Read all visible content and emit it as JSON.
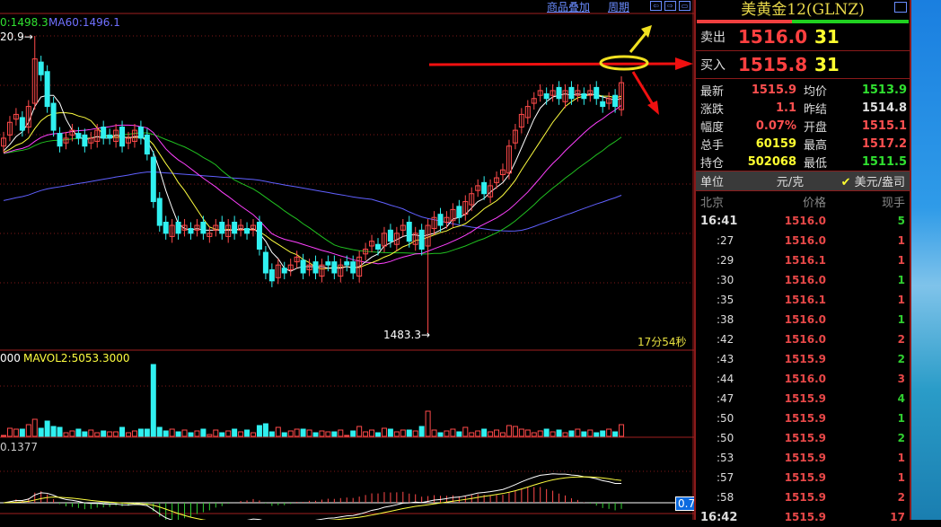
{
  "toolbar": {
    "overlay_link": "商品叠加",
    "period_link": "周期"
  },
  "main_chart": {
    "ma30_label": "0:1498.3",
    "ma60_label": "MA60:1496.1",
    "high_marker": "20.9→",
    "low_marker": "1483.3→",
    "countdown": "17分54秒",
    "colors": {
      "up": "#ff4a4a",
      "down": "#30f0f0",
      "ma5": "#ffffff",
      "ma10": "#ffff40",
      "ma20": "#ff40ff",
      "ma30": "#20c020",
      "ma60": "#6060ff"
    }
  },
  "volume_panel": {
    "mavol1_label": "000",
    "mavol2_label": "MAVOL2:5053.3000"
  },
  "macd_panel": {
    "value_label": "0.1377",
    "badge": "0.7"
  },
  "chart_data": {
    "type": "candlestick",
    "price_range": [
      1483.3,
      1520.9
    ],
    "high": 1520.9,
    "low": 1483.3,
    "closes": [
      1508,
      1510,
      1511,
      1509,
      1512,
      1518,
      1516,
      1512,
      1509,
      1507,
      1508,
      1509,
      1508,
      1507,
      1508,
      1509,
      1508,
      1508,
      1509,
      1507,
      1508,
      1509,
      1508,
      1506,
      1500,
      1497,
      1496,
      1497,
      1496,
      1497,
      1496,
      1497,
      1496,
      1496,
      1497,
      1496,
      1497,
      1496,
      1497,
      1496,
      1497,
      1494,
      1491,
      1490,
      1492,
      1491,
      1492,
      1493,
      1491,
      1492,
      1491,
      1492,
      1492,
      1491,
      1492,
      1492,
      1491,
      1493,
      1494,
      1495,
      1494,
      1496,
      1495,
      1496,
      1497,
      1495,
      1496,
      1494,
      1497,
      1498,
      1497,
      1498,
      1499,
      1498,
      1500,
      1501,
      1502,
      1501,
      1502,
      1503,
      1504,
      1507,
      1509,
      1511,
      1512,
      1513,
      1514,
      1513,
      1514,
      1513,
      1514,
      1513,
      1514,
      1513,
      1514,
      1513,
      1512,
      1513,
      1512,
      1515
    ]
  },
  "instrument": {
    "title": "美黄金12(GLNZ)"
  },
  "quote": {
    "sell_label": "卖出",
    "sell_price": "1516.0",
    "sell_vol": "31",
    "buy_label": "买入",
    "buy_price": "1515.8",
    "buy_vol": "31"
  },
  "stats": [
    {
      "k1": "最新",
      "v1": "1515.9",
      "c1": "#ff5050",
      "k2": "均价",
      "v2": "1513.9",
      "c2": "#30e030"
    },
    {
      "k1": "涨跌",
      "v1": "1.1",
      "c1": "#ff5050",
      "k2": "昨结",
      "v2": "1514.8",
      "c2": "#e0e0e0"
    },
    {
      "k1": "幅度",
      "v1": "0.07%",
      "c1": "#ff5050",
      "k2": "开盘",
      "v2": "1515.1",
      "c2": "#ff5050"
    },
    {
      "k1": "总手",
      "v1": "60159",
      "c1": "#ffff30",
      "k2": "最高",
      "v2": "1517.2",
      "c2": "#ff5050"
    },
    {
      "k1": "持仓",
      "v1": "502068",
      "c1": "#ffff30",
      "k2": "最低",
      "v2": "1511.5",
      "c2": "#30e030"
    }
  ],
  "unit": {
    "label": "单位",
    "opt1": "元/克",
    "opt2": "美元/盎司"
  },
  "trades_header": {
    "time": "北京",
    "price": "价格",
    "vol": "现手"
  },
  "trades": [
    {
      "t": "16:41",
      "p": "1516.0",
      "n": "5",
      "up": false
    },
    {
      "t": ":27",
      "p": "1516.0",
      "n": "1",
      "up": true
    },
    {
      "t": ":29",
      "p": "1516.1",
      "n": "1",
      "up": true
    },
    {
      "t": ":30",
      "p": "1516.0",
      "n": "1",
      "up": false
    },
    {
      "t": ":35",
      "p": "1516.1",
      "n": "1",
      "up": true
    },
    {
      "t": ":38",
      "p": "1516.0",
      "n": "1",
      "up": false
    },
    {
      "t": ":42",
      "p": "1516.0",
      "n": "2",
      "up": true
    },
    {
      "t": ":43",
      "p": "1515.9",
      "n": "2",
      "up": false
    },
    {
      "t": ":44",
      "p": "1516.0",
      "n": "3",
      "up": true
    },
    {
      "t": ":47",
      "p": "1515.9",
      "n": "4",
      "up": false
    },
    {
      "t": ":50",
      "p": "1515.9",
      "n": "1",
      "up": false
    },
    {
      "t": ":50",
      "p": "1515.9",
      "n": "2",
      "up": false
    },
    {
      "t": ":53",
      "p": "1515.9",
      "n": "1",
      "up": true
    },
    {
      "t": ":57",
      "p": "1515.9",
      "n": "1",
      "up": true
    },
    {
      "t": ":58",
      "p": "1515.9",
      "n": "2",
      "up": true
    },
    {
      "t": "16:42",
      "p": "1515.9",
      "n": "17",
      "up": true
    }
  ]
}
